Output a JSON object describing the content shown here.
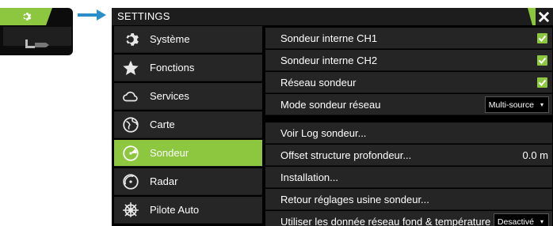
{
  "window": {
    "title": "SETTINGS"
  },
  "colors": {
    "accent": "#8dc63f",
    "row_bg": "#252525",
    "title_bg": "#1d1d1d"
  },
  "sidebar": {
    "items": [
      {
        "label": "Système",
        "icon": "gear-icon",
        "active": false
      },
      {
        "label": "Fonctions",
        "icon": "star-icon",
        "active": false
      },
      {
        "label": "Services",
        "icon": "cloud-icon",
        "active": false
      },
      {
        "label": "Carte",
        "icon": "globe-icon",
        "active": false
      },
      {
        "label": "Sondeur",
        "icon": "sonar-icon",
        "active": true
      },
      {
        "label": "Radar",
        "icon": "radar-icon",
        "active": false
      },
      {
        "label": "Pilote Auto",
        "icon": "helm-icon",
        "active": false
      }
    ]
  },
  "settings": {
    "rows": [
      {
        "label": "Sondeur interne CH1",
        "checked": true
      },
      {
        "label": "Sondeur interne CH2",
        "checked": true
      },
      {
        "label": "Réseau sondeur",
        "checked": true
      },
      {
        "label": "Mode sondeur réseau",
        "dropdown": "Multi-source"
      },
      {
        "label": "Voir Log sondeur..."
      },
      {
        "label": "Offset structure profondeur...",
        "value": "0.0 m"
      },
      {
        "label": "Installation..."
      },
      {
        "label": "Retour réglages usine sondeur..."
      },
      {
        "label": "Utiliser les donnée réseau fond & température",
        "dropdown": "Desactivé"
      }
    ]
  }
}
